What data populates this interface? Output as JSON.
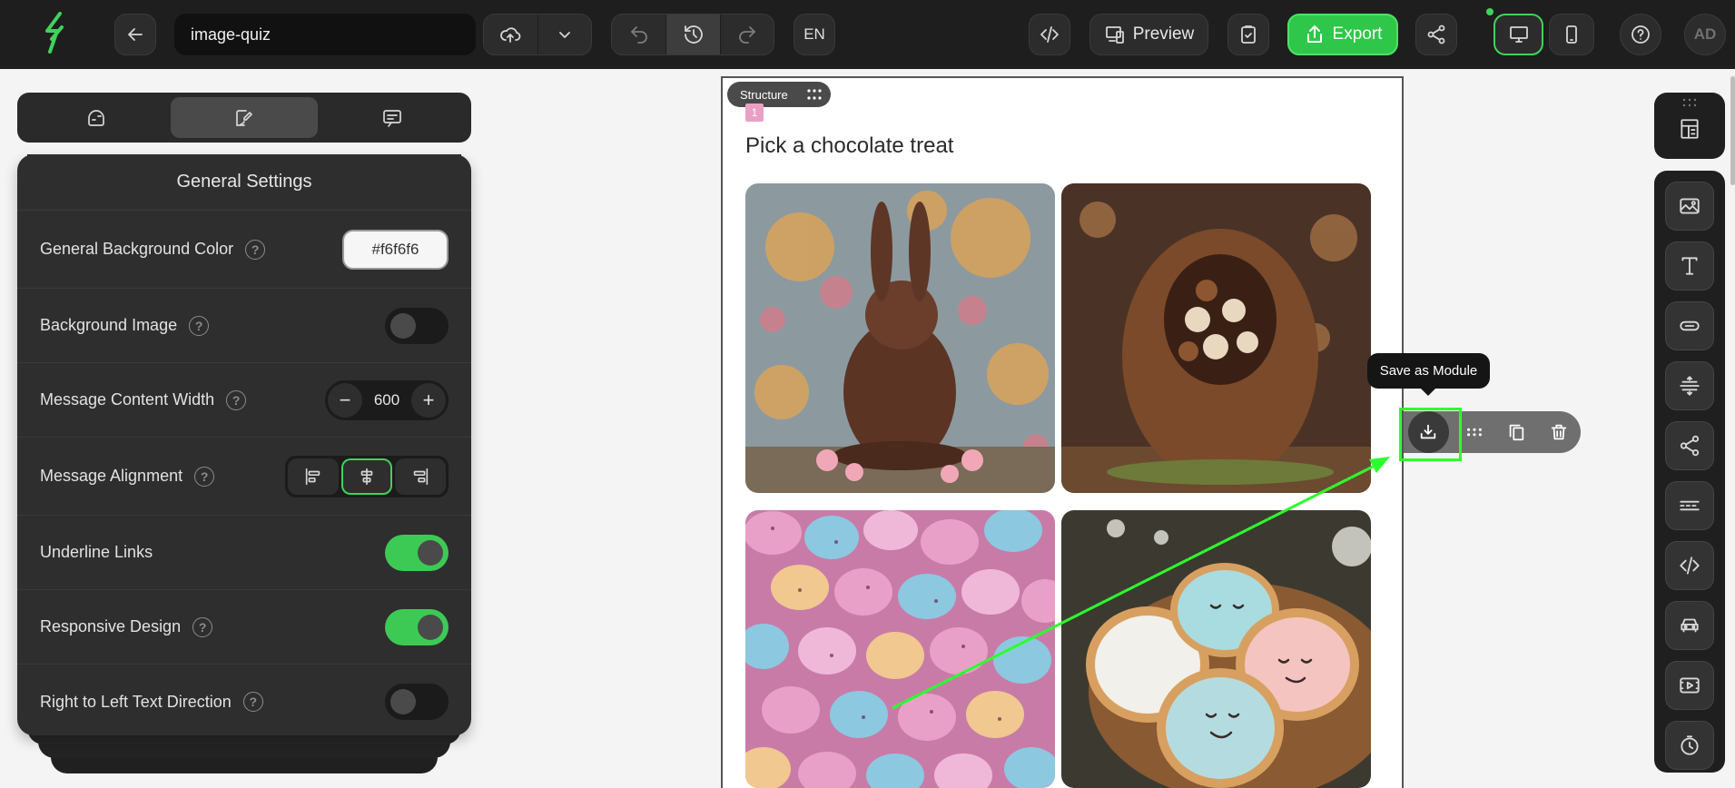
{
  "topbar": {
    "project_name": "image-quiz",
    "language": "EN",
    "preview_label": "Preview",
    "export_label": "Export",
    "user_initials": "AD"
  },
  "left_panel": {
    "title": "General Settings",
    "tabs": [
      "appearance-icon",
      "style-brush-icon",
      "comment-icon"
    ],
    "active_tab": 1,
    "settings": {
      "background_color": {
        "label": "General Background Color",
        "value": "#f6f6f6"
      },
      "background_image": {
        "label": "Background Image",
        "enabled": false
      },
      "content_width": {
        "label": "Message Content Width",
        "value": "600"
      },
      "alignment": {
        "label": "Message Alignment",
        "value": "center"
      },
      "underline_links": {
        "label": "Underline Links",
        "enabled": true
      },
      "responsive_design": {
        "label": "Responsive Design",
        "enabled": true
      },
      "rtl_direction": {
        "label": "Right to Left Text Direction",
        "enabled": false
      }
    }
  },
  "email": {
    "structure_label": "Structure",
    "block_number": "1",
    "quiz_title": "Pick a chocolate treat",
    "images": [
      "chocolate-bunny",
      "chocolate-egg",
      "speckled-candy-eggs",
      "decorated-cookies"
    ]
  },
  "module_toolbar": {
    "tooltip": "Save as Module",
    "buttons": [
      "save-module-icon",
      "drag-handle-icon",
      "duplicate-icon",
      "delete-icon"
    ]
  },
  "right_toolbar": {
    "items": [
      "image-block-icon",
      "text-block-icon",
      "button-block-icon",
      "spacer-block-icon",
      "social-block-icon",
      "divider-block-icon",
      "html-block-icon",
      "menu-block-icon",
      "video-block-icon",
      "timer-block-icon"
    ]
  },
  "colors": {
    "accent": "#2fc74a",
    "highlight": "#2dff2d",
    "panel_bg": "#2e2e2e",
    "topbar_bg": "#1e1e1e"
  }
}
